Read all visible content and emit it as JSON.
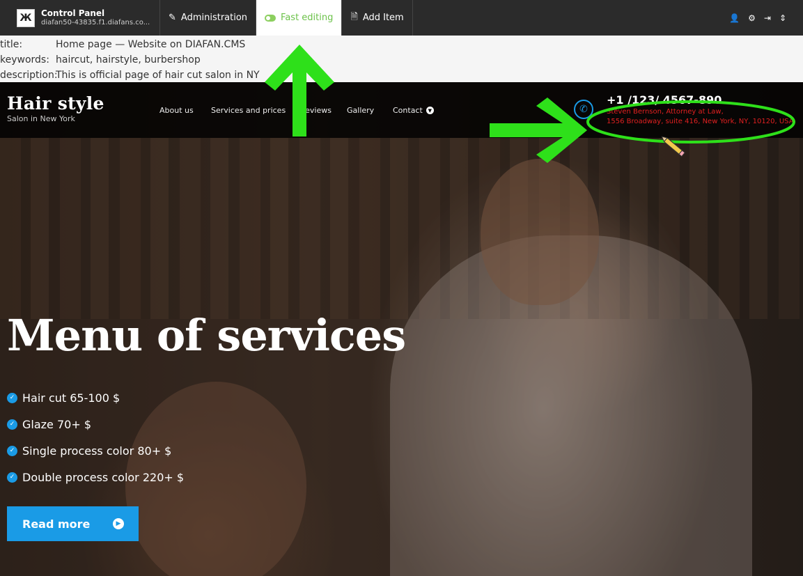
{
  "adminbar": {
    "logo_glyph": "Ж",
    "title": "Control Panel",
    "host": "diafan50-43835.f1.diafans.co...",
    "buttons": [
      {
        "label": "Administration",
        "icon": "pencil-icon"
      },
      {
        "label": "Fast editing",
        "icon": "toggle-on-icon",
        "active": true
      },
      {
        "label": "Add Item",
        "icon": "document-icon"
      }
    ],
    "right_icons": [
      "user-icon",
      "gear-icon",
      "logout-icon",
      "sort-icon"
    ]
  },
  "meta": {
    "rows": [
      {
        "key": "title:",
        "value": "Home page — Website on DIAFAN.CMS"
      },
      {
        "key": "keywords:",
        "value": "haircut, hairstyle, burbershop"
      },
      {
        "key": "description:",
        "value": "This is official page of hair cut salon in NY"
      }
    ]
  },
  "site": {
    "brand_title": "Hair style",
    "brand_sub": "Salon in New York",
    "menu": [
      "About us",
      "Services and prices",
      "Reviews",
      "Gallery",
      "Contact"
    ],
    "phone": "+1 /123/ 4567-890",
    "address_line1": "Steven Bernson, Attorney at Law,",
    "address_line2": "1556 Broadway, suite 416, New York, NY, 10120, USA",
    "hero_title": "Menu of services",
    "services": [
      "Hair cut 65-100 $",
      "Glaze 70+ $",
      "Single process color 80+ $",
      "Double process color 220+ $"
    ],
    "read_more": "Read more"
  },
  "colors": {
    "accent_blue": "#1a9be6",
    "annotation_green": "#2ee01a",
    "fast_edit_green": "#6cc24a",
    "address_red": "#e02020"
  }
}
